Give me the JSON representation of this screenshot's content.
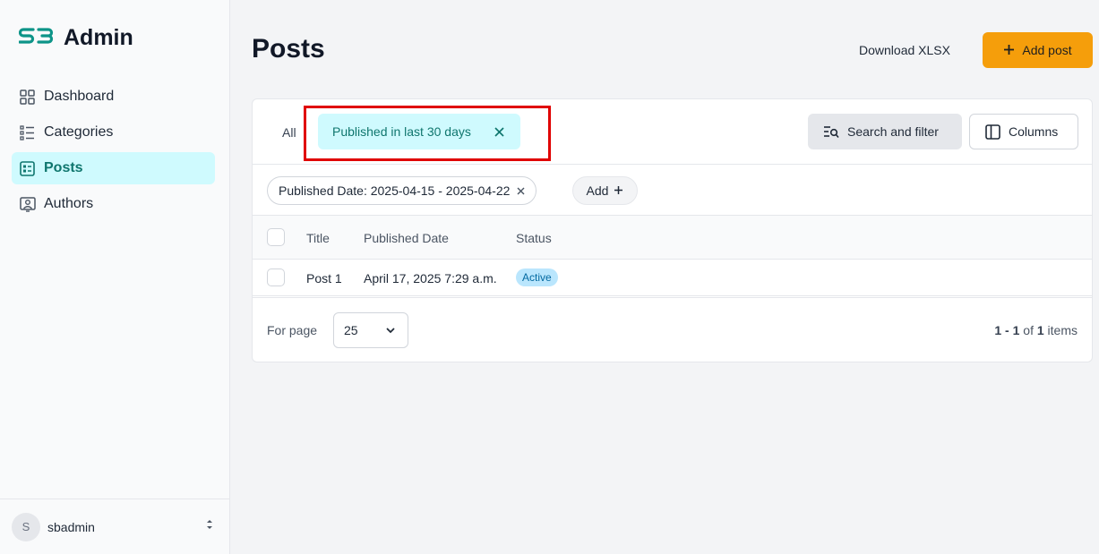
{
  "sidebar": {
    "logo_mark": "SB",
    "logo_text": "Admin",
    "items": [
      {
        "label": "Dashboard",
        "icon": "grid-icon",
        "active": false
      },
      {
        "label": "Categories",
        "icon": "list-icon",
        "active": false
      },
      {
        "label": "Posts",
        "icon": "article-icon",
        "active": true
      },
      {
        "label": "Authors",
        "icon": "user-card-icon",
        "active": false
      }
    ],
    "user": {
      "initial": "S",
      "name": "sbadmin"
    }
  },
  "header": {
    "title": "Posts",
    "download_label": "Download XLSX",
    "add_label": "Add post"
  },
  "tabs": {
    "all_label": "All",
    "active_label": "Published in last 30 days"
  },
  "toolbar": {
    "search_label": "Search and filter",
    "columns_label": "Columns"
  },
  "filters": {
    "chip_label": "Published Date: 2025-04-15 - 2025-04-22",
    "add_label": "Add"
  },
  "table": {
    "columns": [
      "Title",
      "Published Date",
      "Status"
    ],
    "rows": [
      {
        "title": "Post 1",
        "published_date": "April 17, 2025 7:29 a.m.",
        "status": "Active"
      }
    ]
  },
  "pagination": {
    "per_page_label": "For page",
    "per_page_value": "25",
    "range": "1 - 1",
    "of": "of",
    "total": "1",
    "items": "items"
  },
  "colors": {
    "accent": "#0d9488",
    "active_bg": "#cffafe",
    "primary_button": "#f59e0b",
    "highlight": "#e00000",
    "status_badge": "#bae6fd"
  }
}
